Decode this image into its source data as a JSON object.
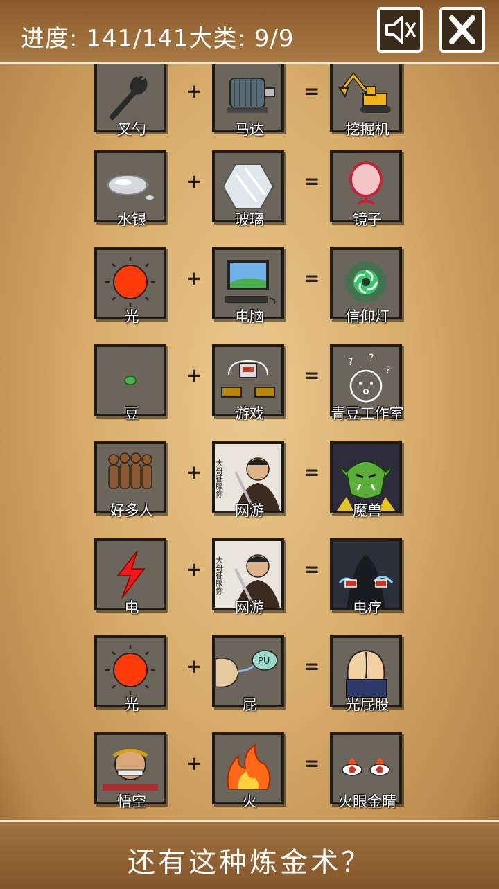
{
  "header": {
    "progress_text": "进度: 141/141大类: 9/9",
    "sound_button": "speaker-muted-icon",
    "close_button": "close-icon"
  },
  "recipes": [
    {
      "a": "叉勺",
      "b": "马达",
      "result": "挖掘机",
      "icons": [
        "spork-icon",
        "motor-icon",
        "excavator-icon"
      ]
    },
    {
      "a": "水银",
      "b": "玻璃",
      "result": "镜子",
      "icons": [
        "mercury-icon",
        "glass-icon",
        "mirror-icon"
      ]
    },
    {
      "a": "光",
      "b": "电脑",
      "result": "信仰灯",
      "icons": [
        "sun-icon",
        "computer-icon",
        "faith-light-icon"
      ]
    },
    {
      "a": "豆",
      "b": "游戏",
      "result": "青豆工作室",
      "icons": [
        "bean-icon",
        "game-controller-icon",
        "question-face-icon"
      ]
    },
    {
      "a": "好多人",
      "b": "网游",
      "result": "魔兽",
      "icons": [
        "crowd-icon",
        "online-game-icon",
        "orc-icon"
      ]
    },
    {
      "a": "电",
      "b": "网游",
      "result": "电疗",
      "icons": [
        "lightning-icon",
        "online-game-icon",
        "electrotherapy-icon"
      ]
    },
    {
      "a": "光",
      "b": "屁",
      "result": "光屁股",
      "icons": [
        "sun-icon",
        "fart-icon",
        "bare-butt-icon"
      ]
    },
    {
      "a": "悟空",
      "b": "火",
      "result": "火眼金睛",
      "icons": [
        "wukong-icon",
        "fire-icon",
        "fiery-eyes-icon"
      ]
    }
  ],
  "operators": {
    "plus": "+",
    "equals": "="
  },
  "online_game_caption": "大哥征服你",
  "fart_text": "PU",
  "footer": {
    "text": "还有这种炼金术？"
  }
}
